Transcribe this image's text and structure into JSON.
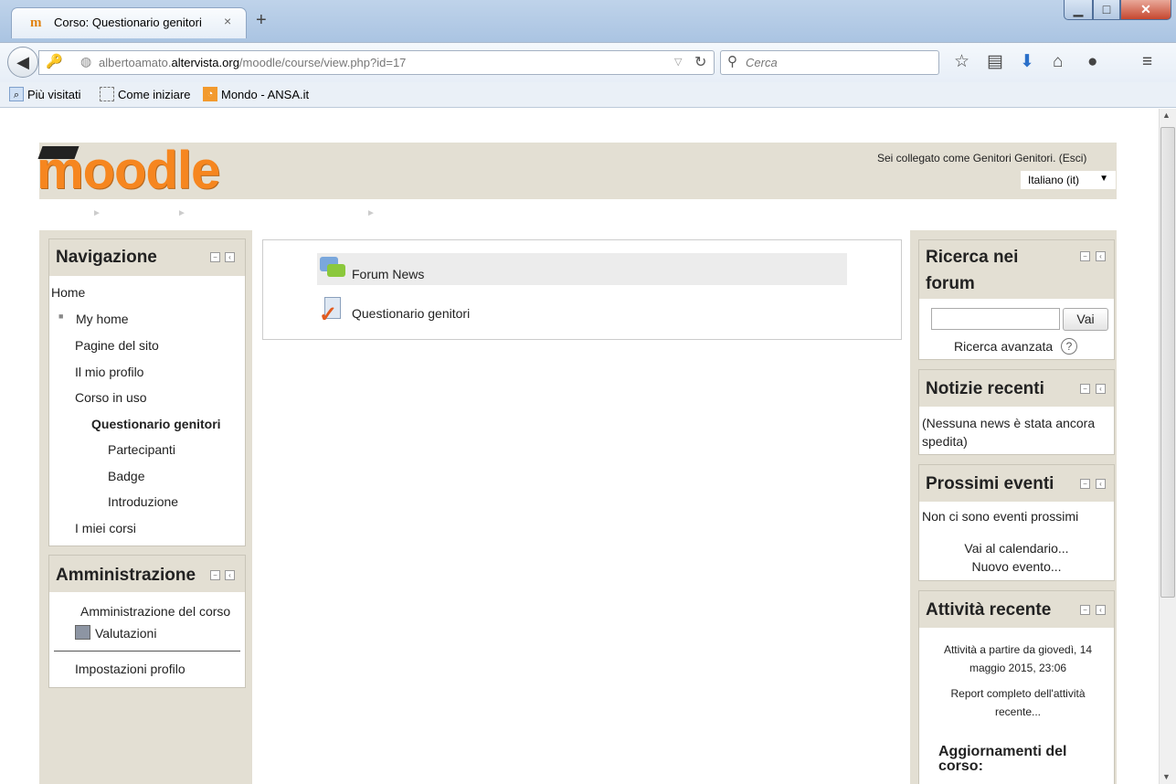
{
  "browser": {
    "tab_title": "Corso: Questionario genitori",
    "tab_close": "×",
    "new_tab": "+",
    "url_prefix": "albertoamato.",
    "url_domain": "altervista.org",
    "url_path": "/moodle/course/view.php?id=17",
    "search_placeholder": "Cerca",
    "bookmarks": [
      "Più visitati",
      "Come iniziare",
      "Mondo - ANSA.it"
    ]
  },
  "header": {
    "logo": "moodle",
    "login_info": "Sei collegato come Genitori Genitori. (Esci)",
    "language": "Italiano (it)"
  },
  "navigation": {
    "title": "Navigazione",
    "items": [
      "Home",
      "My home",
      "Pagine del sito",
      "Il mio profilo",
      "Corso in uso",
      "Questionario genitori",
      "Partecipanti",
      "Badge",
      "Introduzione",
      "I miei corsi"
    ]
  },
  "administration": {
    "title": "Amministrazione",
    "items": [
      "Amministrazione del corso",
      "Valutazioni",
      "Impostazioni profilo"
    ]
  },
  "center": {
    "activities": [
      "Forum News",
      "Questionario genitori"
    ]
  },
  "search_forums": {
    "title_line1": "Ricerca nei",
    "title_line2": "forum",
    "button": "Vai",
    "advanced": "Ricerca avanzata"
  },
  "recent_news": {
    "title": "Notizie recenti",
    "text": "(Nessuna news è stata ancora spedita)"
  },
  "upcoming_events": {
    "title": "Prossimi eventi",
    "text": "Non ci sono eventi prossimi",
    "calendar_link": "Vai al calendario...",
    "new_event_link": "Nuovo evento..."
  },
  "recent_activity": {
    "title": "Attività recente",
    "since": "Attività a partire da giovedì, 14 maggio 2015, 23:06",
    "full_report": "Report completo dell'attività recente...",
    "updates_title": "Aggiornamenti del corso:"
  }
}
